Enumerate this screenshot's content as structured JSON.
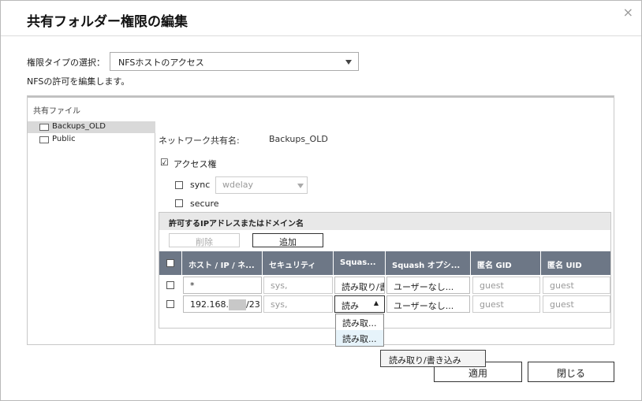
{
  "dialog": {
    "title": "共有フォルダー権限の編集",
    "close_glyph": "×"
  },
  "permission_type": {
    "label": "権限タイプの選択：",
    "selected": "NFSホストのアクセス"
  },
  "description": "NFSの許可を編集します。",
  "shared_files": {
    "header": "共有ファイル",
    "folders": [
      {
        "label": "Backups_OLD",
        "selected": true
      },
      {
        "label": "Public",
        "selected": false
      }
    ]
  },
  "settings": {
    "network_share_label": "ネットワーク共有名:",
    "network_share_value": "Backups_OLD",
    "access_label": "アクセス権",
    "access_checked": true,
    "sync_label": "sync",
    "sync_mode": "wdelay",
    "secure_label": "secure"
  },
  "hosts": {
    "header": "許可するIPアドレスまたはドメイン名",
    "delete_label": "削除",
    "add_label": "追加",
    "columns": [
      "ホスト / IP / ネ...",
      "セキュリティ",
      "Squas...",
      "Squash オプシ...",
      "匿名 GID",
      "匿名 UID"
    ],
    "rows": [
      {
        "host": "*",
        "security": "sys,",
        "squash": "読み取り/書",
        "squash_option": "ユーザーなし...",
        "gid": "guest",
        "uid": "guest"
      },
      {
        "host_prefix": "192.168.",
        "host_suffix": "/23",
        "security": "sys,",
        "squash": "読み",
        "squash_option": "ユーザーなし...",
        "gid": "guest",
        "uid": "guest"
      }
    ]
  },
  "dropdown_options": [
    "読み取...",
    "読み取..."
  ],
  "tooltip": "読み取り/書き込み",
  "footer": {
    "apply_label": "適用",
    "close_label": "閉じる"
  }
}
